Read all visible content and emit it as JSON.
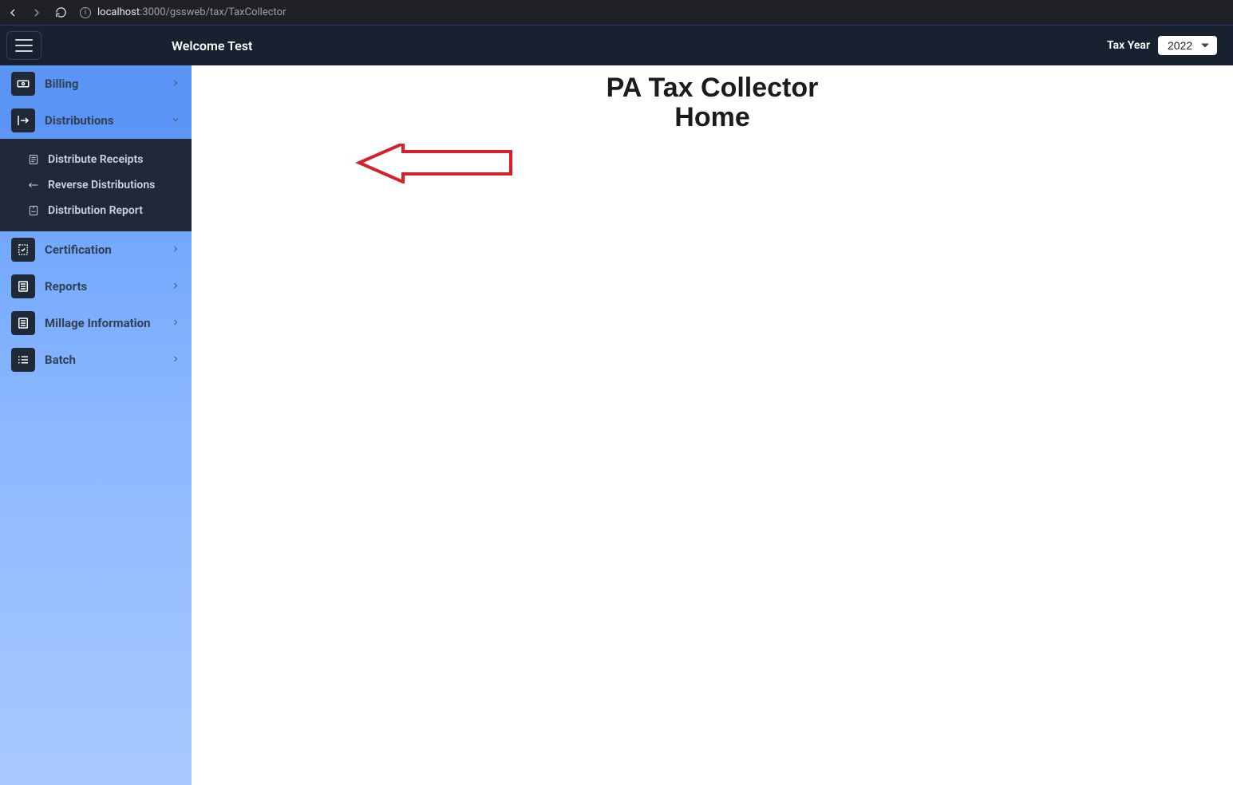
{
  "browser": {
    "url_host": "localhost",
    "url_port_path": ":3000/gssweb/tax/TaxCollector"
  },
  "header": {
    "welcome": "Welcome Test",
    "tax_year_label": "Tax Year",
    "tax_year_value": "2022"
  },
  "sidebar": {
    "items": [
      {
        "label": "Billing",
        "icon": "billing",
        "expandable": true,
        "expanded": false
      },
      {
        "label": "Distributions",
        "icon": "distributions",
        "expandable": true,
        "expanded": true,
        "children": [
          {
            "label": "Distribute Receipts",
            "icon": "receipt"
          },
          {
            "label": "Reverse Distributions",
            "icon": "reverse"
          },
          {
            "label": "Distribution Report",
            "icon": "report"
          }
        ]
      },
      {
        "label": "Certification",
        "icon": "certification",
        "expandable": true,
        "expanded": false
      },
      {
        "label": "Reports",
        "icon": "reports",
        "expandable": true,
        "expanded": false
      },
      {
        "label": "Millage Information",
        "icon": "millage",
        "expandable": true,
        "expanded": false
      },
      {
        "label": "Batch",
        "icon": "batch",
        "expandable": true,
        "expanded": false
      }
    ]
  },
  "main": {
    "title_line1": "PA Tax Collector",
    "title_line2": "Home"
  }
}
